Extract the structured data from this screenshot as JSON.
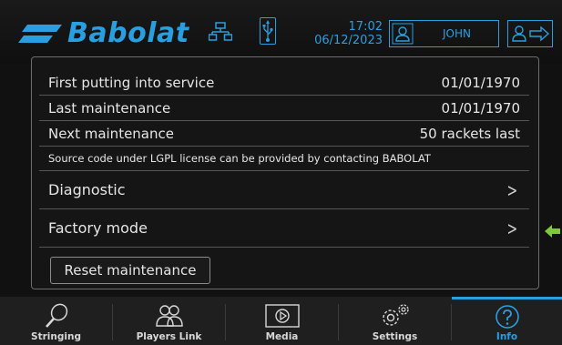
{
  "brand": {
    "name": "Babolat"
  },
  "header": {
    "time": "17:02",
    "date": "06/12/2023",
    "user": "JOHN"
  },
  "info_rows": [
    {
      "label": "First putting into service",
      "value": "01/01/1970"
    },
    {
      "label": "Last maintenance",
      "value": "01/01/1970"
    },
    {
      "label": "Next maintenance",
      "value": "50 rackets last"
    }
  ],
  "license_note": "Source code under LGPL license can be provided by contacting BABOLAT",
  "menu": {
    "diagnostic": "Diagnostic",
    "factory_mode": "Factory mode",
    "chevron": ">"
  },
  "reset_button": "Reset maintenance",
  "tabs": [
    {
      "label": "Stringing",
      "icon": "racket-icon"
    },
    {
      "label": "Players Link",
      "icon": "players-icon"
    },
    {
      "label": "Media",
      "icon": "media-icon"
    },
    {
      "label": "Settings",
      "icon": "gears-icon"
    },
    {
      "label": "Info",
      "icon": "help-icon",
      "active": true
    }
  ],
  "colors": {
    "accent": "#2a9fe0",
    "indicator": "#7ec83a",
    "text": "#e6e6e6"
  }
}
